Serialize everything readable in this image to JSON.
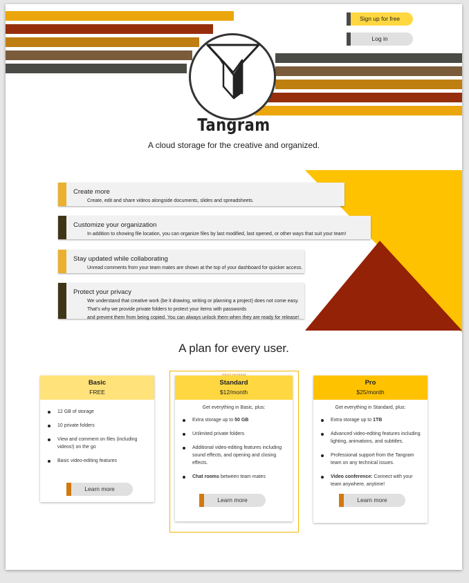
{
  "header": {
    "signup_label": "Sign up for free",
    "login_label": "Log in",
    "brand_name": "Tangram",
    "tagline": "A cloud storage for the creative and organized."
  },
  "features": [
    {
      "title": "Create more",
      "description": "Create, edit and share videos alongside documents, slides and spreadsheets.",
      "accent": "#EBB030"
    },
    {
      "title": "Customize your organization",
      "description": "In addition to showing file location, you can organize files by last modified, last opened, or other ways that suit your team!",
      "accent": "#3F3617"
    },
    {
      "title": "Stay updated while collaborating",
      "description": "Unread comments from your team mates are shown at the top of your dashboard for quicker access.",
      "accent": "#EBB030"
    },
    {
      "title": "Protect your privacy",
      "description": "We understand that creative work (be it drawing, writing or planning a project) does not come easy.\nThat's why we provide private folders to protect your items with passwords\nand prevent them from being copied. You can always unlock them when they are ready for release!",
      "accent": "#3F3617"
    }
  ],
  "plans": {
    "title": "A plan for every user.",
    "popular_label": "most popular",
    "learn_more": "Learn more",
    "basic": {
      "name": "Basic",
      "price": "FREE",
      "header_color": "#FFE27A",
      "items": [
        "12 GB of storage",
        "10 private folders",
        "View and comment on files (including videos!) on the go",
        "Basic video-editing features"
      ]
    },
    "standard": {
      "name": "Standard",
      "price": "$12/month",
      "header_color": "#FFD740",
      "intro": "Get everything in Basic, plus:",
      "item1_prefix": "Extra storage up to ",
      "item1_bold": "50 GB",
      "item2": "Unlimited private folders",
      "item3": "Additional video-editing features including sound effects, and opening and closing effects.",
      "item4_bold": "Chat rooms",
      "item4_rest": " between team mates"
    },
    "pro": {
      "name": "Pro",
      "price": "$25/month",
      "header_color": "#FFC200",
      "intro": "Get everything in Standard, plus:",
      "item1_prefix": "Extra storage up to ",
      "item1_bold": "1TB",
      "item2": "Advanced video-editing features including lighting, animations, and subtitles.",
      "item3": "Professional support from the Tangram team on any technical issues.",
      "item4_bold": "Video conference:",
      "item4_rest": " Connect with your team anywhere, anytime!"
    }
  },
  "icons": [
    "tangram-logo-icon"
  ]
}
